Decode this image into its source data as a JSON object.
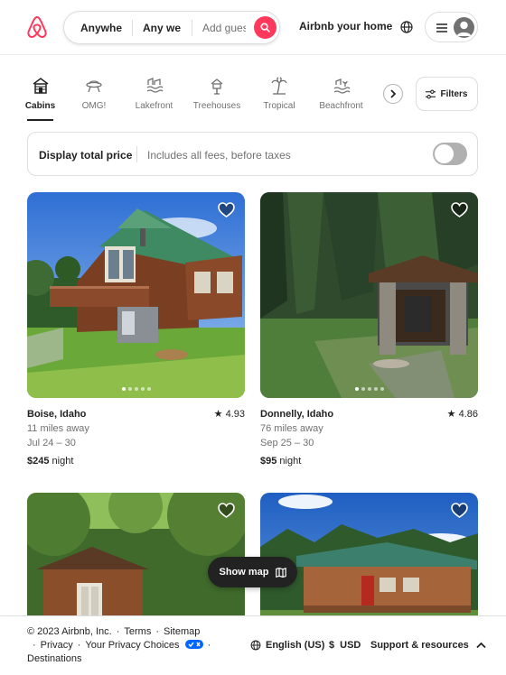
{
  "header": {
    "search": {
      "where": "Anywhere",
      "when": "Any week",
      "who_placeholder": "Add guests"
    },
    "host_link": "Airbnb your home",
    "brand_color": "#FF385C"
  },
  "categories": {
    "items": [
      {
        "label": "Cabins",
        "icon": "cabin-icon",
        "active": true
      },
      {
        "label": "OMG!",
        "icon": "ufo-house-icon",
        "active": false
      },
      {
        "label": "Lakefront",
        "icon": "lakefront-icon",
        "active": false
      },
      {
        "label": "Treehouses",
        "icon": "treehouse-icon",
        "active": false
      },
      {
        "label": "Tropical",
        "icon": "palm-tree-icon",
        "active": false
      },
      {
        "label": "Beachfront",
        "icon": "beach-icon",
        "active": false
      }
    ],
    "filters_label": "Filters"
  },
  "price_toggle": {
    "label": "Display total price",
    "sublabel": "Includes all fees, before taxes",
    "enabled": false
  },
  "listings": [
    {
      "location": "Boise, Idaho",
      "rating": "4.93",
      "distance": "11 miles away",
      "dates": "Jul 24 – 30",
      "price": "$245",
      "price_unit": "night",
      "photo_count": 5,
      "photo_index": 1
    },
    {
      "location": "Donnelly, Idaho",
      "rating": "4.86",
      "distance": "76 miles away",
      "dates": "Sep 25 – 30",
      "price": "$95",
      "price_unit": "night",
      "photo_count": 5,
      "photo_index": 1
    },
    {
      "location": "",
      "rating": "",
      "distance": "",
      "dates": "",
      "price": "",
      "price_unit": ""
    },
    {
      "location": "",
      "rating": "",
      "distance": "",
      "dates": "",
      "price": "",
      "price_unit": ""
    }
  ],
  "show_map": "Show map",
  "footer": {
    "copyright": "© 2023 Airbnb, Inc.",
    "links": [
      "Terms",
      "Sitemap",
      "Privacy",
      "Your Privacy Choices",
      "Destinations"
    ],
    "language": "English (US)",
    "currency_symbol": "$",
    "currency": "USD",
    "support": "Support & resources"
  }
}
